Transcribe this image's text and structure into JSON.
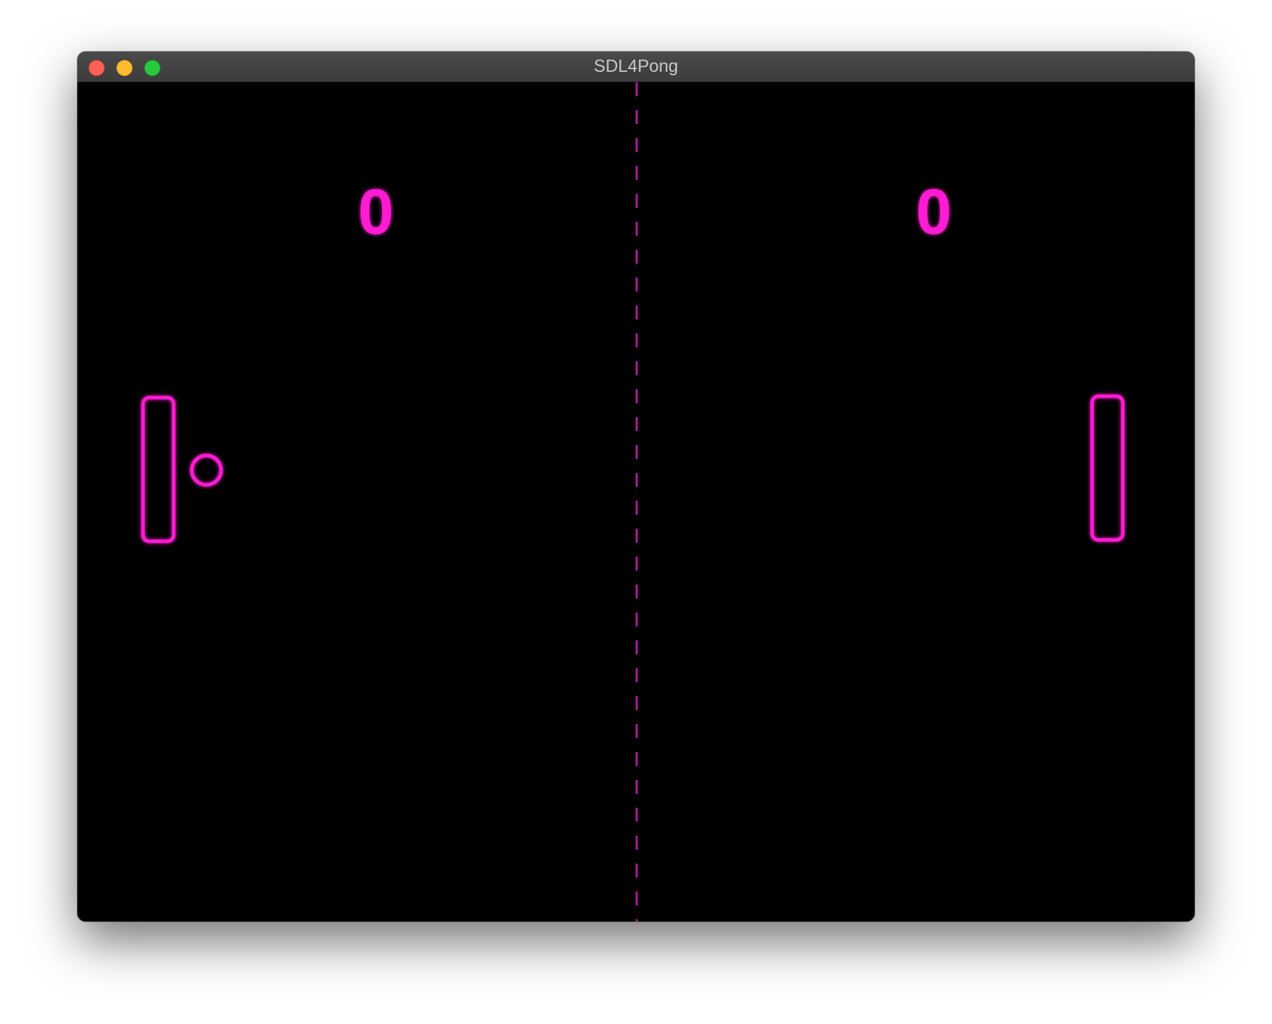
{
  "window": {
    "title": "SDL4Pong"
  },
  "game": {
    "score_left": "0",
    "score_right": "0",
    "neon_color": "#ff1fd2",
    "background_color": "#000000"
  },
  "icons": {
    "close": "close-icon",
    "minimize": "minimize-icon",
    "zoom": "zoom-icon"
  }
}
